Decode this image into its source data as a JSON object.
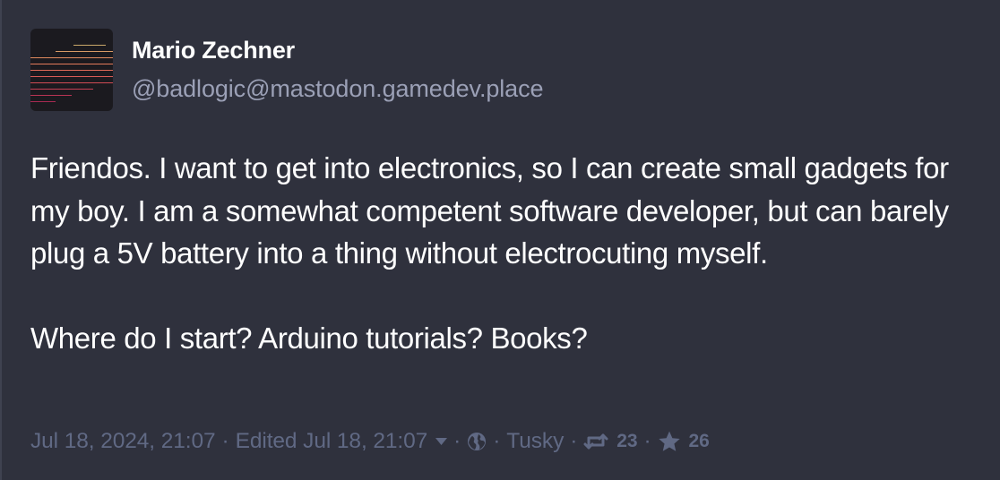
{
  "status": {
    "account": {
      "display_name": "Mario Zechner",
      "handle": "@badlogic@mastodon.gamedev.place",
      "avatar_icon": "striped-lines-avatar"
    },
    "content": {
      "paragraphs": [
        "Friendos. I want to get into electronics, so I can create small gadgets for my boy. I am a somewhat competent software developer, but can barely plug a 5V battery into a thing without electrocuting myself.",
        "Where do I start? Arduino tutorials? Books?"
      ]
    },
    "meta": {
      "timestamp": "Jul 18, 2024, 21:07",
      "edited": "Edited Jul 18, 21:07",
      "separator": "·",
      "visibility_icon": "globe-icon",
      "application": "Tusky",
      "reblogs_icon": "boost-icon",
      "reblogs_count": "23",
      "favourites_icon": "star-icon",
      "favourites_count": "26"
    }
  },
  "colors": {
    "background": "#2f313d",
    "text": "#ffffff",
    "handle": "#9ba0b6",
    "meta": "#606984"
  }
}
